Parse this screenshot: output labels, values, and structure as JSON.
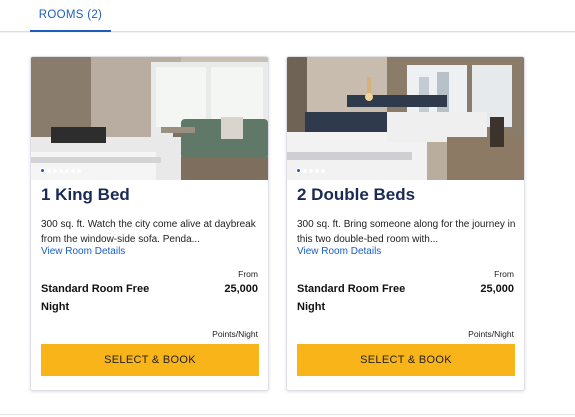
{
  "tabs": [
    {
      "label": "ROOMS (2)"
    }
  ],
  "colors": {
    "accent": "#1c5dbf",
    "title": "#1a2a55",
    "button": "#f8b419"
  },
  "rooms": [
    {
      "title": "1 King Bed",
      "description": "300 sq. ft. Watch the city come alive at daybreak from the window-side sofa. Penda...",
      "details_link": "View Room Details",
      "from_label": "From",
      "rate_name": "Standard Room Free Night",
      "price": "25,000",
      "unit": "Points/Night",
      "book_label": "SELECT & BOOK",
      "carousel_dots": 7,
      "carousel_active": 1
    },
    {
      "title": "2 Double Beds",
      "description": "300 sq. ft. Bring someone along for the journey in this two double-bed room with...",
      "details_link": "View Room Details",
      "from_label": "From",
      "rate_name": "Standard Room Free Night",
      "price": "25,000",
      "unit": "Points/Night",
      "book_label": "SELECT & BOOK",
      "carousel_dots": 5,
      "carousel_active": 1
    }
  ]
}
